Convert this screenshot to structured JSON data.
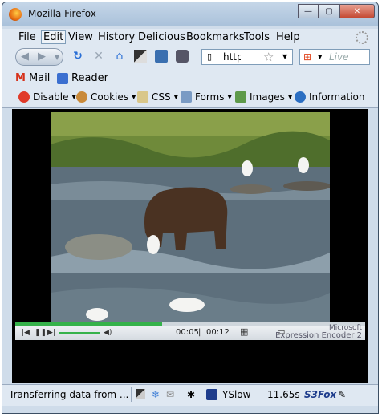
{
  "window": {
    "title": "Mozilla Firefox"
  },
  "menu": [
    "File",
    "Edit",
    "View",
    "History",
    "Delicious",
    "Bookmarks",
    "Tools",
    "Help"
  ],
  "nav": {
    "url": "http://l",
    "search_placeholder": "Live"
  },
  "bookmarks": [
    {
      "label": "Mail",
      "icon": "gmail-icon"
    },
    {
      "label": "Reader",
      "icon": "rss-icon"
    }
  ],
  "devtools": [
    {
      "label": "Disable",
      "icon": "disable-icon"
    },
    {
      "label": "Cookies",
      "icon": "cookies-icon"
    },
    {
      "label": "CSS",
      "icon": "css-icon"
    },
    {
      "label": "Forms",
      "icon": "forms-icon"
    },
    {
      "label": "Images",
      "icon": "images-icon"
    },
    {
      "label": "Information",
      "icon": "information-icon"
    }
  ],
  "player": {
    "elapsed": "00:05",
    "duration": "00:12",
    "progress": 0.42,
    "volume": 0.6,
    "brand_small": "Microsoft",
    "brand": "Expression Encoder 2"
  },
  "status": {
    "text": "Transferring data from ...",
    "yslow": "YSlow",
    "load_time": "11.65s",
    "s3fox": "S3Fox"
  }
}
